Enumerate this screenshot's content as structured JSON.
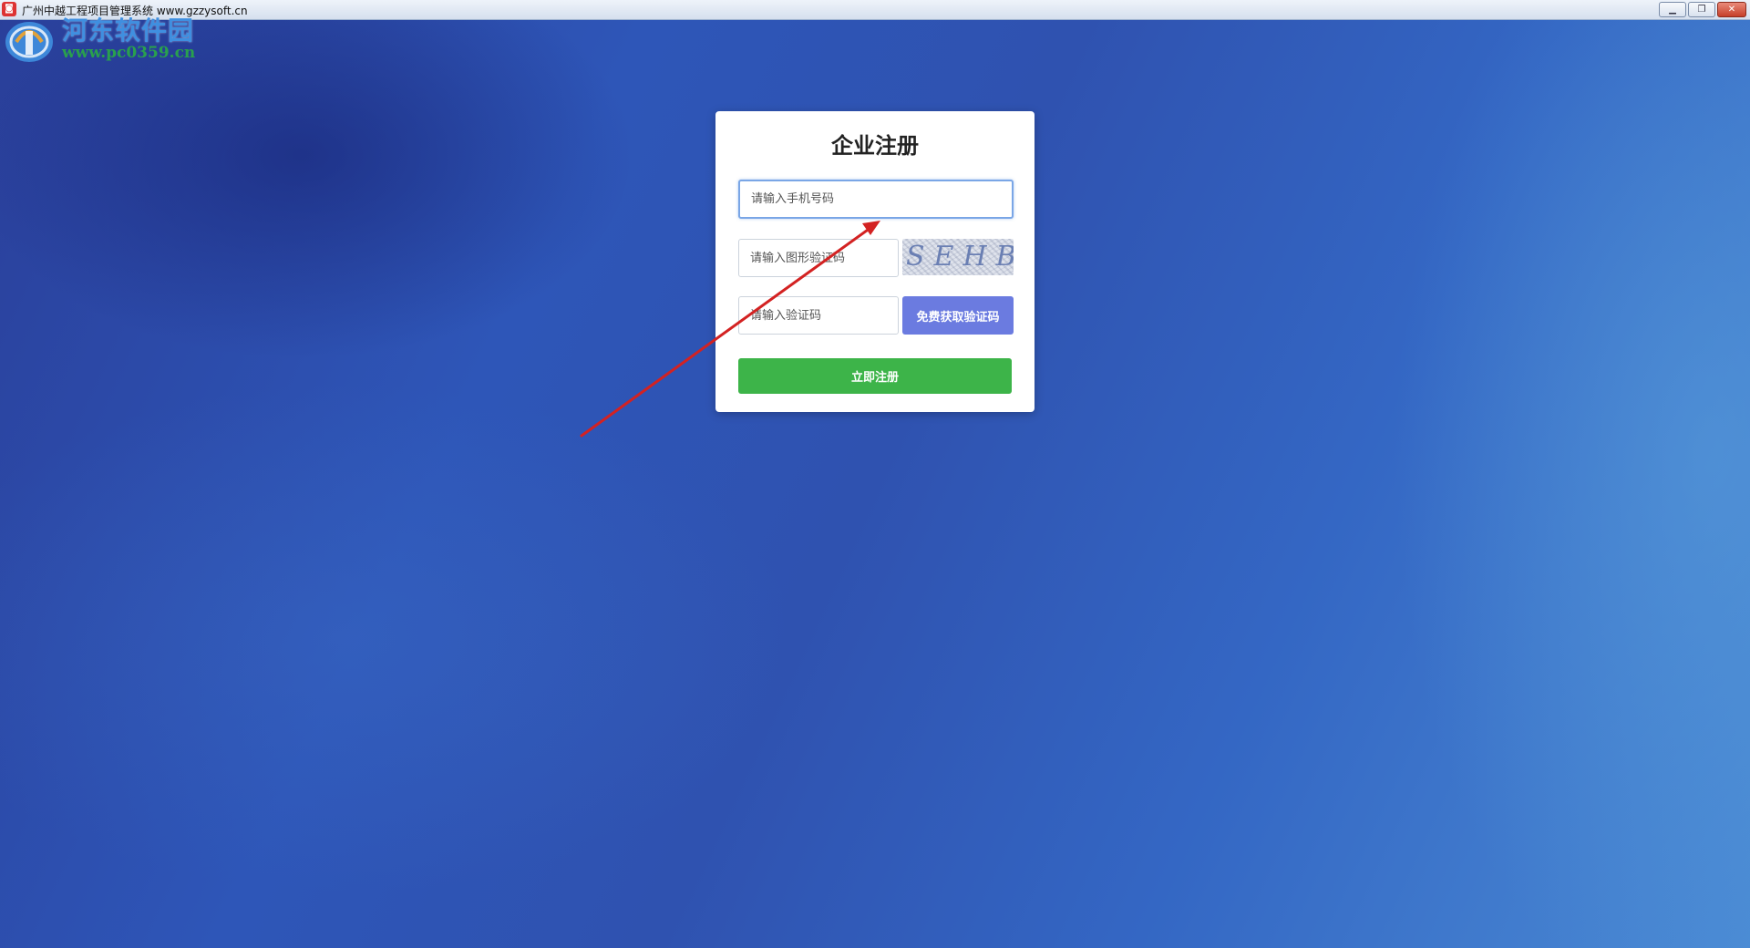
{
  "window": {
    "title": "广州中越工程项目管理系统 www.gzzysoft.cn",
    "app_icon": "app-logo-icon",
    "buttons": [
      "minimize-icon",
      "restore-icon",
      "close-icon"
    ]
  },
  "watermark": {
    "name": "河东软件园",
    "url": "www.pc0359.cn"
  },
  "form": {
    "title": "企业注册",
    "phone_placeholder": "请输入手机号码",
    "captcha_placeholder": "请输入图形验证码",
    "captcha_image_text": "SEHB",
    "sms_placeholder": "请输入验证码",
    "sms_button_label": "免费获取验证码",
    "register_button_label": "立即注册"
  },
  "colors": {
    "register_button": "#3db449",
    "sms_button": "#6b7be0",
    "annotation_arrow": "#d32222"
  }
}
